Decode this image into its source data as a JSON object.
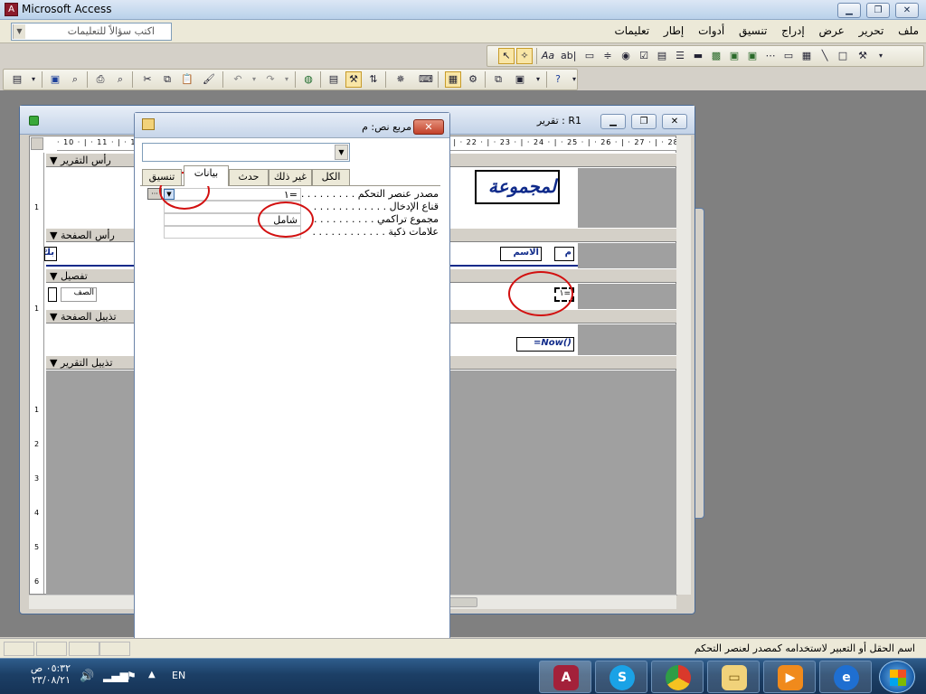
{
  "window": {
    "title": "Microsoft Access"
  },
  "menubar": {
    "ask_placeholder": "اكتب سؤالاً للتعليمات",
    "menus": [
      "ملف",
      "تحرير",
      "عرض",
      "إدراج",
      "تنسيق",
      "أدوات",
      "إطار",
      "تعليمات"
    ]
  },
  "report_window": {
    "title": "R1 : تقرير"
  },
  "ruler": {
    "top": "· 10 · | · 11 · | · 12 · | · 13 · | · 14 · | · 15 · | · 16 · | · 17 · | · 18 · | · 19 · | · 20 · | · 21 · | · 22 · | · 23 · | · 24 · | · 25 · | · 26 · | · 27 · | · 28"
  },
  "sections": {
    "report_header": "رأس التقرير",
    "page_header": "رأس الصفحة",
    "detail": "تفصيل",
    "page_footer": "تذييل الصفحة",
    "report_footer": "تذييل التقرير"
  },
  "design": {
    "title_label": "لمجموعة",
    "col_m": "م",
    "col_name": "الاسم",
    "col_left": "بك",
    "detail_class": "الصف",
    "detail_expr": "=١",
    "footer_expr": "=Now()"
  },
  "property_sheet": {
    "title": "مربع نص: م",
    "selected_control": "م",
    "tabs": [
      "الكل",
      "غير ذلك",
      "حدث",
      "بيانات",
      "تنسيق"
    ],
    "rows": [
      {
        "label": "مصدر عنصر التحكم . . . . . . . . .",
        "value": "=١"
      },
      {
        "label": "قناع الإدخال . . . . . . . . . . . .",
        "value": ""
      },
      {
        "label": "مجموع تراكمي . . . . . . . . . .",
        "value": "شامل"
      },
      {
        "label": "علامات ذكية . . . . . . . . . . . .",
        "value": ""
      }
    ]
  },
  "status": {
    "text": "اسم الحقل أو التعبير لاستخدامه كمصدر لعنصر التحكم"
  },
  "taskbar": {
    "time": "٠٥:٣٢ ص",
    "date": "٢٣/٠٨/٢١",
    "lang": "EN"
  },
  "colors": {
    "title_blue": "#0f2a8a",
    "circle_red": "#d21010",
    "taskbar": "#1c3f66"
  }
}
